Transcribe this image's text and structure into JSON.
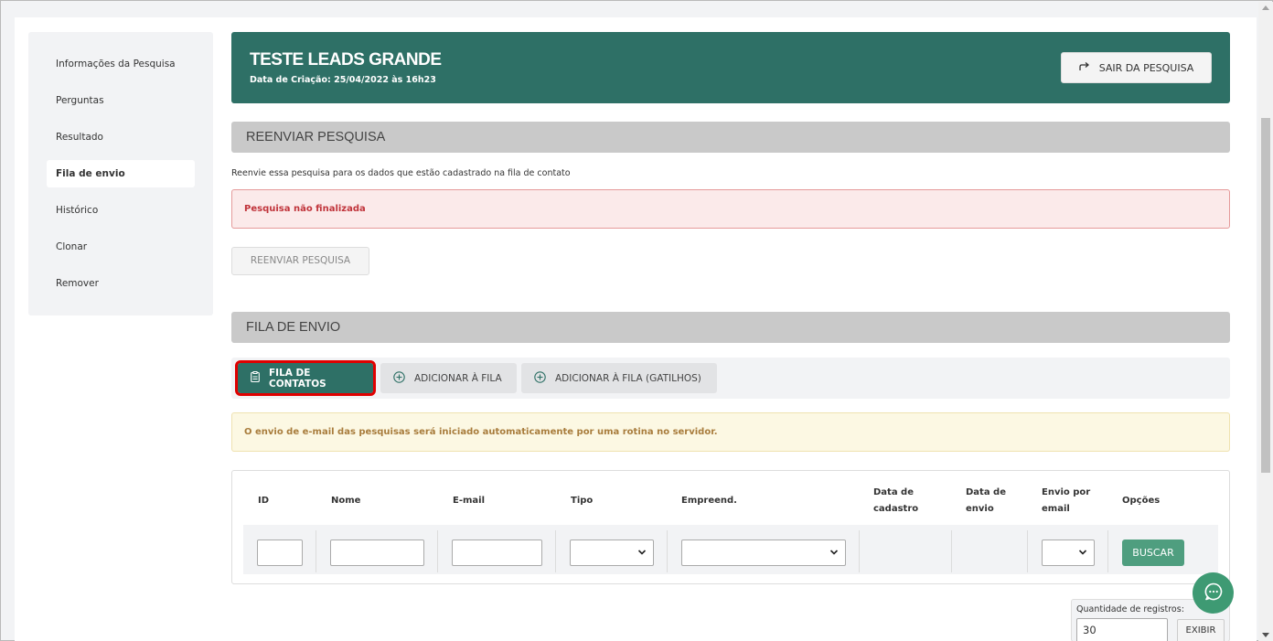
{
  "sidebar": {
    "items": [
      {
        "label": "Informações da Pesquisa",
        "active": false
      },
      {
        "label": "Perguntas",
        "active": false
      },
      {
        "label": "Resultado",
        "active": false
      },
      {
        "label": "Fila de envio",
        "active": true
      },
      {
        "label": "Histórico",
        "active": false
      },
      {
        "label": "Clonar",
        "active": false
      },
      {
        "label": "Remover",
        "active": false
      }
    ]
  },
  "header": {
    "title": "TESTE LEADS GRANDE",
    "subtitle": "Data de Criação: 25/04/2022 às 16h23",
    "exit_button": "SAIR DA PESQUISA",
    "background_color": "#2e7066"
  },
  "resend": {
    "section_title": "REENVIAR PESQUISA",
    "description": "Reenvie essa pesquisa para os dados que estão cadastrado na fila de contato",
    "alert": "Pesquisa não finalizada",
    "button": "REENVIAR PESQUISA"
  },
  "queue": {
    "section_title": "FILA DE ENVIO",
    "tabs": [
      {
        "label": "FILA DE CONTATOS",
        "icon": "clipboard-icon",
        "active": true
      },
      {
        "label": "ADICIONAR À FILA",
        "icon": "plus-circle-icon",
        "active": false
      },
      {
        "label": "ADICIONAR À FILA (GATILHOS)",
        "icon": "plus-circle-icon",
        "active": false
      }
    ],
    "info_alert": "O envio de e-mail das pesquisas será iniciado automaticamente por uma rotina no servidor."
  },
  "table": {
    "columns": [
      {
        "line1": "ID",
        "line2": ""
      },
      {
        "line1": "Nome",
        "line2": ""
      },
      {
        "line1": "E-mail",
        "line2": ""
      },
      {
        "line1": "Tipo",
        "line2": ""
      },
      {
        "line1": "Empreend.",
        "line2": ""
      },
      {
        "line1": "Data de",
        "line2": "cadastro"
      },
      {
        "line1": "Data de",
        "line2": "envio"
      },
      {
        "line1": "Envio por",
        "line2": "email"
      },
      {
        "line1": "Opções",
        "line2": ""
      }
    ],
    "filters": {
      "id": "",
      "nome": "",
      "email": "",
      "tipo": "",
      "empreend": "",
      "envio_email": ""
    },
    "search_button": "BUSCAR"
  },
  "pagination": {
    "quantity_label": "Quantidade de registros:",
    "quantity_value": "30",
    "show_button": "EXIBIR"
  },
  "chat": {
    "icon": "chat-bubble-icon",
    "color": "#3e9a73"
  }
}
